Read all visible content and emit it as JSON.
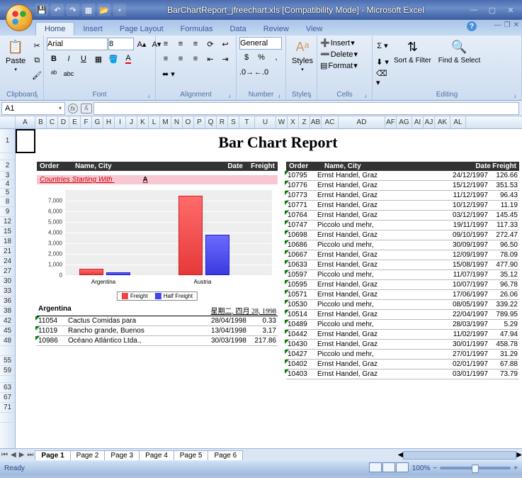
{
  "window": {
    "title": "BarChartReport_jfreechart.xls  [Compatibility Mode] - Microsoft Excel"
  },
  "tabs": [
    "Home",
    "Insert",
    "Page Layout",
    "Formulas",
    "Data",
    "Review",
    "View"
  ],
  "ribbon": {
    "clipboard": {
      "label": "Clipboard",
      "paste": "Paste"
    },
    "font": {
      "label": "Font",
      "name": "Arial",
      "size": "8"
    },
    "alignment": {
      "label": "Alignment"
    },
    "number": {
      "label": "Number",
      "format": "General"
    },
    "styles": {
      "label": "Styles",
      "btn": "Styles"
    },
    "cells": {
      "label": "Cells",
      "insert": "Insert",
      "delete": "Delete",
      "format": "Format"
    },
    "editing": {
      "label": "Editing",
      "sort": "Sort & Filter",
      "find": "Find & Select"
    }
  },
  "namebox": "A1",
  "fx_label": "fx",
  "columns": [
    "A",
    "B",
    "C",
    "D",
    "E",
    "F",
    "G",
    "H",
    "I",
    "J",
    "K",
    "L",
    "M",
    "N",
    "O",
    "P",
    "Q",
    "R",
    "S",
    "T",
    "U",
    "W",
    "X",
    "Z",
    "AB",
    "AC",
    "AD",
    "AF",
    "AG",
    "AI",
    "AJ",
    "AK",
    "AL"
  ],
  "rownums": [
    "1",
    "",
    "2",
    "3",
    "4",
    "5",
    "8",
    "9",
    "12",
    "15",
    "18",
    "21",
    "24",
    "27",
    "30",
    "33",
    "36",
    "38",
    "42",
    "45",
    "48",
    "",
    "55",
    "59",
    "",
    "63",
    "67",
    "71",
    ""
  ],
  "report": {
    "title": "Bar Chart Report",
    "headers": [
      "Order",
      "Name, City",
      "Date",
      "Freight"
    ],
    "headers_r": [
      "Order",
      "Name, City",
      "Date",
      "Freight"
    ],
    "subhead": "Countries Starting With",
    "subhead_letter": "A",
    "country": "Argentina",
    "country_date": "星期二, 四月  28, 1998",
    "left_rows": [
      {
        "o": "11054",
        "n": "Cactus Comidas para",
        "d": "28/04/1998",
        "f": "0.33"
      },
      {
        "o": "11019",
        "n": "Rancho grande, Buenos",
        "d": "13/04/1998",
        "f": "3.17"
      },
      {
        "o": "10986",
        "n": "Océano Atlántico Ltda.,",
        "d": "30/03/1998",
        "f": "217.86"
      }
    ],
    "right_rows": [
      {
        "o": "10795",
        "n": "Ernst Handel, Graz",
        "d": "24/12/1997",
        "f": "126.66"
      },
      {
        "o": "10776",
        "n": "Ernst Handel, Graz",
        "d": "15/12/1997",
        "f": "351.53"
      },
      {
        "o": "10773",
        "n": "Ernst Handel, Graz",
        "d": "11/12/1997",
        "f": "96.43"
      },
      {
        "o": "10771",
        "n": "Ernst Handel, Graz",
        "d": "10/12/1997",
        "f": "11.19"
      },
      {
        "o": "10764",
        "n": "Ernst Handel, Graz",
        "d": "03/12/1997",
        "f": "145.45"
      },
      {
        "o": "10747",
        "n": "Piccolo und mehr,",
        "d": "19/11/1997",
        "f": "117.33"
      },
      {
        "o": "10698",
        "n": "Ernst Handel, Graz",
        "d": "09/10/1997",
        "f": "272.47"
      },
      {
        "o": "10686",
        "n": "Piccolo und mehr,",
        "d": "30/09/1997",
        "f": "96.50"
      },
      {
        "o": "10667",
        "n": "Ernst Handel, Graz",
        "d": "12/09/1997",
        "f": "78.09"
      },
      {
        "o": "10633",
        "n": "Ernst Handel, Graz",
        "d": "15/08/1997",
        "f": "477.90"
      },
      {
        "o": "10597",
        "n": "Piccolo und mehr,",
        "d": "11/07/1997",
        "f": "35.12"
      },
      {
        "o": "10595",
        "n": "Ernst Handel, Graz",
        "d": "10/07/1997",
        "f": "96.78"
      },
      {
        "o": "10571",
        "n": "Ernst Handel, Graz",
        "d": "17/06/1997",
        "f": "26.06"
      },
      {
        "o": "10530",
        "n": "Piccolo und mehr,",
        "d": "08/05/1997",
        "f": "339.22"
      },
      {
        "o": "10514",
        "n": "Ernst Handel, Graz",
        "d": "22/04/1997",
        "f": "789.95"
      },
      {
        "o": "10489",
        "n": "Piccolo und mehr,",
        "d": "28/03/1997",
        "f": "5.29"
      },
      {
        "o": "10442",
        "n": "Ernst Handel, Graz",
        "d": "11/02/1997",
        "f": "47.94"
      },
      {
        "o": "10430",
        "n": "Ernst Handel, Graz",
        "d": "30/01/1997",
        "f": "458.78"
      },
      {
        "o": "10427",
        "n": "Piccolo und mehr,",
        "d": "27/01/1997",
        "f": "31.29"
      },
      {
        "o": "10402",
        "n": "Ernst Handel, Graz",
        "d": "02/01/1997",
        "f": "67.88"
      },
      {
        "o": "10403",
        "n": "Ernst Handel, Graz",
        "d": "03/01/1997",
        "f": "73.79"
      }
    ]
  },
  "chart_data": {
    "type": "bar",
    "categories": [
      "Argentina",
      "Austria"
    ],
    "series": [
      {
        "name": "Freight",
        "values": [
          600,
          7500
        ]
      },
      {
        "name": "Half Freight",
        "values": [
          300,
          3800
        ]
      }
    ],
    "ylim": [
      0,
      8000
    ],
    "yticks": [
      0,
      1000,
      2000,
      3000,
      4000,
      5000,
      6000,
      7000
    ]
  },
  "sheets": [
    "Page 1",
    "Page 2",
    "Page 3",
    "Page 4",
    "Page 5",
    "Page 6"
  ],
  "status": {
    "ready": "Ready",
    "zoom": "100%"
  }
}
